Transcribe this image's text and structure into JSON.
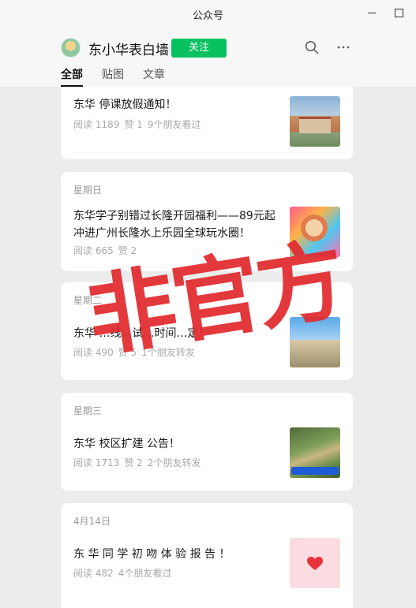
{
  "window": {
    "title": "公众号"
  },
  "account": {
    "name": "东小华表白墙",
    "follow_label": "关注"
  },
  "tabs": [
    {
      "label": "全部"
    },
    {
      "label": "贴图"
    },
    {
      "label": "文章"
    }
  ],
  "articles": [
    {
      "day": "",
      "title": "东华 停课放假通知！",
      "stats": [
        "阅读 1189",
        "赞 1",
        "9个朋友看过"
      ],
      "thumb": "campus-building-photo"
    },
    {
      "day": "星期日",
      "title": "东华学子别错过长隆开园福利——89元起冲进广州长隆水上乐园全球玩水圈！",
      "stats": [
        "阅读 665",
        "赞 2"
      ],
      "thumb": "water-park-poster"
    },
    {
      "day": "星期二",
      "title": "东华 …线…试…时间…定！",
      "stats": [
        "阅读 490",
        "赞 5",
        "1个朋友转发"
      ],
      "thumb": "blue-sky-photo"
    },
    {
      "day": "星期三",
      "title": "东华 校区扩建 公告！",
      "stats": [
        "阅读 1713",
        "赞 2",
        "2个朋友转发"
      ],
      "thumb": "aerial-construction-photo"
    },
    {
      "day": "4月14日",
      "title": "东 华 同 学 初 吻 体 验 报 告 ！",
      "stats": [
        "阅读 482",
        "4个朋友看过"
      ],
      "thumb": "heart-image"
    }
  ],
  "watermark": {
    "text": "非官方"
  },
  "colors": {
    "accent": "#07c160",
    "watermark": "#e12b2f",
    "background": "#ececec"
  },
  "icons": [
    "search-icon",
    "more-icon",
    "minimize-icon",
    "maximize-icon"
  ]
}
